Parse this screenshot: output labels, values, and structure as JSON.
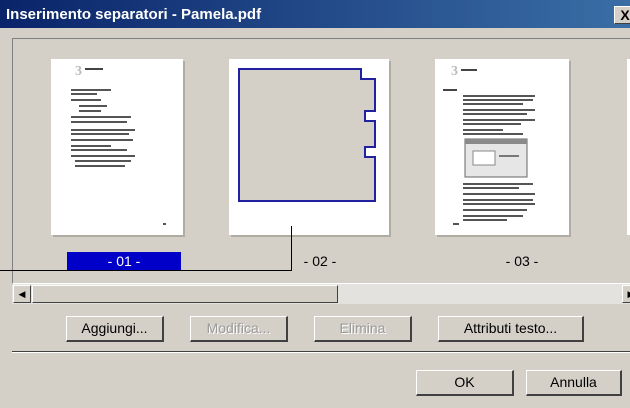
{
  "window": {
    "title": "Inserimento separatori - Pamela.pdf",
    "close_glyph": "X"
  },
  "pages": [
    {
      "label": "- 01 -",
      "selected": true,
      "type": "document"
    },
    {
      "label": "- 02 -",
      "selected": false,
      "type": "separator"
    },
    {
      "label": "- 03 -",
      "selected": false,
      "type": "document"
    }
  ],
  "scrollbar": {
    "left_arrow": "◀",
    "right_arrow": "▶"
  },
  "actions": {
    "add": "Aggiungi...",
    "edit": "Modifica...",
    "delete": "Elimina",
    "text_attributes": "Attributi testo..."
  },
  "footer": {
    "ok": "OK",
    "cancel": "Annulla"
  },
  "colors": {
    "title_bar": "#0a246a",
    "selection": "#0000c8",
    "separator_outline": "#2020a0"
  }
}
